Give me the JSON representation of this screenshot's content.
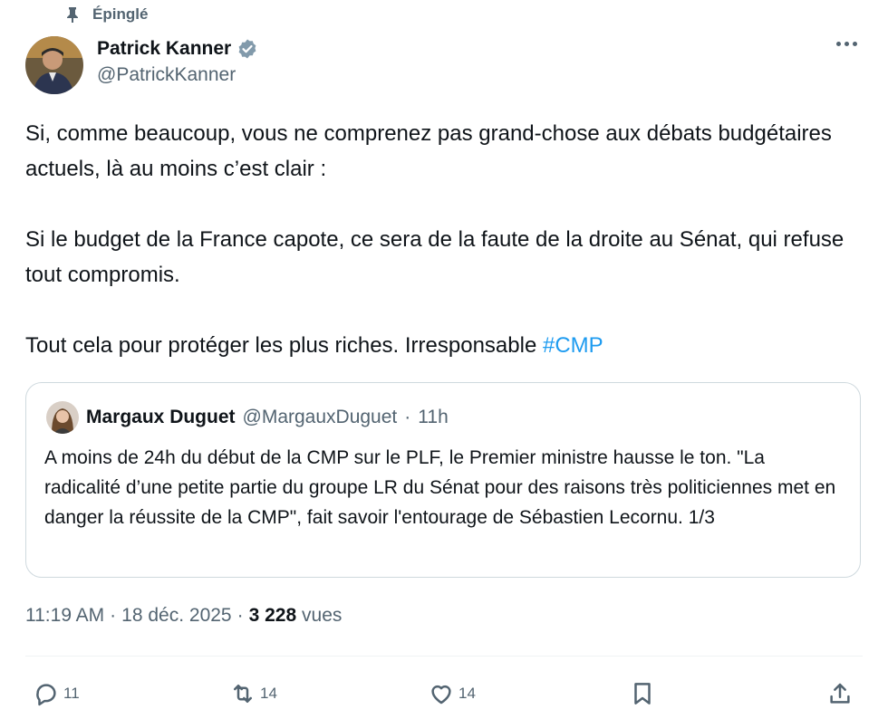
{
  "pinned": {
    "label": "Épinglé",
    "icon": "pin-icon"
  },
  "author": {
    "name": "Patrick Kanner",
    "handle": "@PatrickKanner",
    "verified": true
  },
  "tweet": {
    "paragraphs": [
      "Si, comme beaucoup, vous ne comprenez pas grand-chose aux débats budgétaires actuels, là au moins c’est clair :",
      "Si le budget de la France capote, ce sera de la faute de la droite au Sénat, qui refuse tout compromis."
    ],
    "last_paragraph": "Tout cela pour protéger les plus riches. Irresponsable ",
    "hashtag": "#CMP"
  },
  "quote": {
    "name": "Margaux Duguet",
    "handle": "@MargauxDuguet",
    "separator": "·",
    "time": "11h",
    "text": "A moins de 24h du début de la CMP sur le PLF, le Premier ministre hausse le ton. \"La radicalité d’une petite partie du groupe LR du Sénat pour des raisons très politiciennes met en danger la réussite de la CMP\", fait savoir l'entourage de Sébastien Lecornu. 1/3"
  },
  "meta": {
    "time": "11:19 AM",
    "sep1": "·",
    "date": "18 déc. 2025",
    "sep2": "·",
    "views": "3 228",
    "views_label": "vues"
  },
  "actions": {
    "replies": "11",
    "reposts": "14",
    "likes": "14"
  },
  "colors": {
    "accent": "#1d9bf0",
    "secondary_text": "#536471",
    "border": "#cfd9de"
  }
}
